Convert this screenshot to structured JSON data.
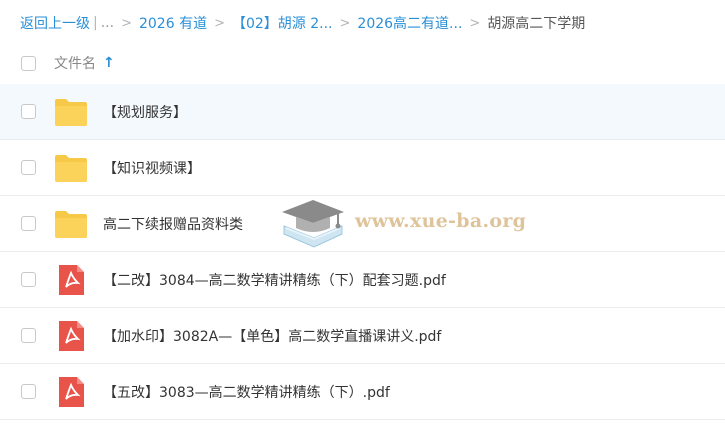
{
  "breadcrumb": {
    "back": "返回上一级",
    "pipe": "|",
    "ellipsis": "...",
    "sep": ">",
    "items": [
      "2026 有道",
      "【02】胡源 2...",
      "2026高二有道...",
      "胡源高二下学期"
    ]
  },
  "header": {
    "column_label": "文件名",
    "sort": "ascending"
  },
  "files": [
    {
      "type": "folder",
      "name": "【规划服务】"
    },
    {
      "type": "folder",
      "name": "【知识视频课】"
    },
    {
      "type": "folder",
      "name": "高二下续报赠品资料类"
    },
    {
      "type": "pdf",
      "name": "【二改】3084—高二数学精讲精练（下）配套习题.pdf"
    },
    {
      "type": "pdf",
      "name": "【加水印】3082A—【单色】高二数学直播课讲义.pdf"
    },
    {
      "type": "pdf",
      "name": "【五改】3083—高二数学精讲精练（下）.pdf"
    }
  ],
  "watermark": {
    "text": "www.xue-ba.org"
  },
  "colors": {
    "link": "#2b8fd6",
    "folder": "#f7c948",
    "pdf": "#e8534a",
    "watermark": "#d9b98a"
  }
}
